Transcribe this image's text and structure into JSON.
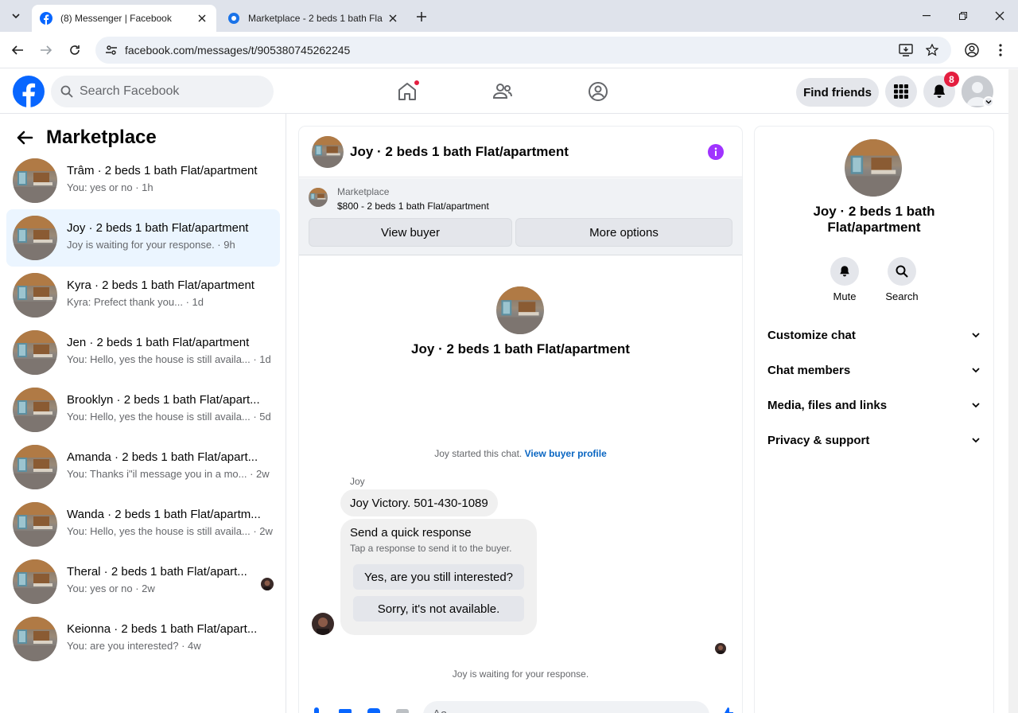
{
  "browser": {
    "tabs": [
      {
        "title": "(8) Messenger | Facebook",
        "active": true
      },
      {
        "title": "Marketplace - 2 beds 1 bath Fla",
        "active": false
      }
    ],
    "url": "facebook.com/messages/t/905380745262245"
  },
  "header": {
    "search_placeholder": "Search Facebook",
    "find_friends": "Find friends",
    "notification_count": "8"
  },
  "sidebar": {
    "title": "Marketplace",
    "conversations": [
      {
        "name": "Trâm · 2 beds 1 bath Flat/apartment",
        "preview": "You: yes or no · 1h",
        "selected": false
      },
      {
        "name": "Joy · 2 beds 1 bath Flat/apartment",
        "preview": "Joy is waiting for your response. · 9h",
        "selected": true
      },
      {
        "name": "Kyra · 2 beds 1 bath Flat/apartment",
        "preview": "Kyra: Prefect thank you... · 1d",
        "selected": false
      },
      {
        "name": "Jen · 2 beds 1 bath Flat/apartment",
        "preview": "You: Hello, yes the house is still availa... · 1d",
        "selected": false
      },
      {
        "name": "Brooklyn · 2 beds 1 bath Flat/apart...",
        "preview": "You: Hello, yes the house is still availa... · 5d",
        "selected": false
      },
      {
        "name": "Amanda · 2 beds 1 bath Flat/apart...",
        "preview": "You: Thanks i\"il message you in a mo... · 2w",
        "selected": false
      },
      {
        "name": "Wanda · 2 beds 1 bath Flat/apartm...",
        "preview": "You: Hello, yes the house is still availa... · 2w",
        "selected": false
      },
      {
        "name": "Theral · 2 beds 1 bath Flat/apart...",
        "preview": "You: yes or no · 2w",
        "selected": false
      },
      {
        "name": "Keionna · 2 beds 1 bath Flat/apart...",
        "preview": "You: are you interested? · 4w",
        "selected": false
      }
    ]
  },
  "chat": {
    "title": "Joy · 2 beds 1 bath Flat/apartment",
    "marketplace_label": "Marketplace",
    "listing": "$800 - 2 beds 1 bath Flat/apartment",
    "view_buyer": "View buyer",
    "more_options": "More options",
    "intro_name": "Joy · 2 beds 1 bath Flat/apartment",
    "started_text": "Joy started this chat.",
    "view_profile": "View buyer profile",
    "sender": "Joy",
    "message": "Joy Victory.  501-430-1089",
    "quick_title": "Send a quick response",
    "quick_sub": "Tap a response to send it to the buyer.",
    "quick_1": "Yes, are you still interested?",
    "quick_2": "Sorry, it's not available.",
    "waiting": "Joy is waiting for your response.",
    "composer_placeholder": "Aa"
  },
  "details": {
    "name": "Joy · 2 beds 1 bath Flat/apartment",
    "mute": "Mute",
    "search": "Search",
    "sections": [
      "Customize chat",
      "Chat members",
      "Media, files and links",
      "Privacy & support"
    ]
  },
  "icons": {
    "fb_blue": "#0866ff",
    "messenger_purple": "#a033ff"
  }
}
